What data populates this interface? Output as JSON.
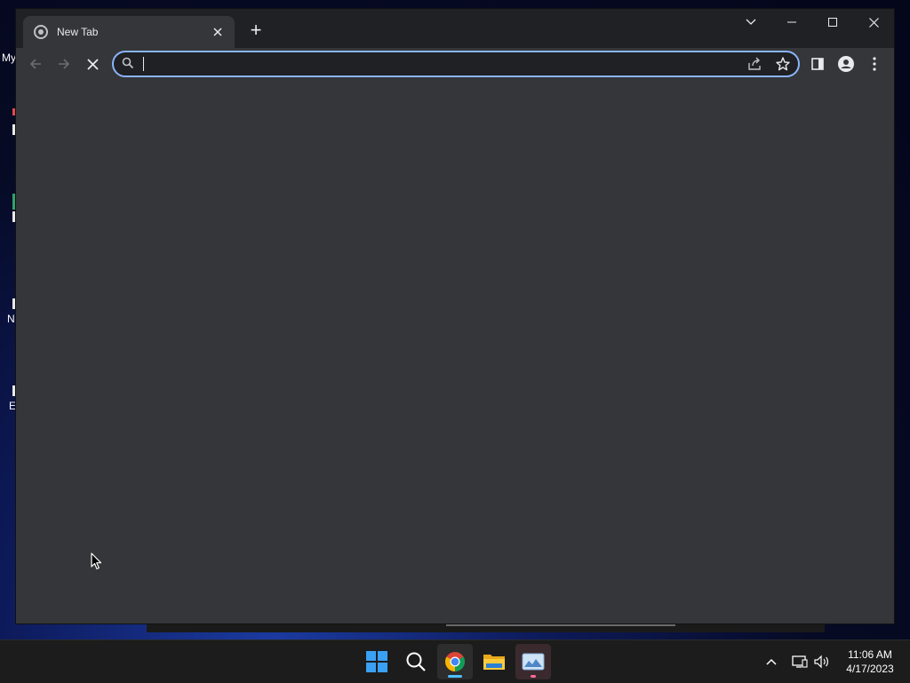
{
  "desktop": {
    "labels": [
      "My",
      "N",
      "E"
    ]
  },
  "browser": {
    "tab": {
      "title": "New Tab",
      "close_icon": "close-icon",
      "favicon": "chrome-newtab-icon"
    },
    "new_tab_symbol": "+",
    "window_controls": {
      "tab_search_icon": "chevron-down-icon",
      "minimize_icon": "minimize-icon",
      "maximize_icon": "maximize-icon",
      "close_icon": "close-icon"
    },
    "toolbar": {
      "back_icon": "arrow-left-icon",
      "forward_icon": "arrow-right-icon",
      "stop_icon": "stop-x-icon",
      "omnibox": {
        "value": "",
        "placeholder": "",
        "search_icon": "search-icon"
      },
      "share_icon": "share-icon",
      "bookmark_icon": "star-icon",
      "side_panel_icon": "side-panel-icon",
      "profile_icon": "profile-icon",
      "menu_icon": "kebab-menu-icon"
    }
  },
  "taskbar": {
    "apps": [
      {
        "name": "Start",
        "icon": "windows-start-icon"
      },
      {
        "name": "Search",
        "icon": "search-icon"
      },
      {
        "name": "Google Chrome",
        "icon": "chrome-icon",
        "active": true
      },
      {
        "name": "File Explorer",
        "icon": "folder-icon"
      },
      {
        "name": "Photos",
        "icon": "photos-icon"
      }
    ],
    "tray": {
      "overflow_icon": "chevron-up-icon",
      "network_icon": "network-icon",
      "volume_icon": "speaker-icon"
    },
    "clock": {
      "time": "11:06 AM",
      "date": "4/17/2023"
    }
  },
  "colors": {
    "tabstrip": "#202124",
    "toolbar": "#35363a",
    "focus_ring": "#8ab4f8",
    "taskbar": "#1c1c1c",
    "chrome_indicator": "#4cc2ff",
    "photos_indicator": "#ff6b9a"
  }
}
